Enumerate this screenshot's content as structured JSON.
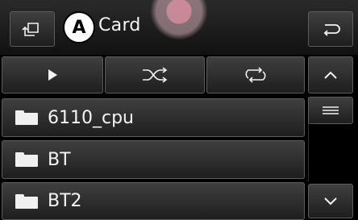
{
  "header": {
    "title": "Card",
    "annotation_marker": "A"
  },
  "controls": {
    "play": "play-icon",
    "shuffle": "shuffle-icon",
    "repeat": "repeat-icon"
  },
  "nav": {
    "back": "back-icon",
    "home": "folder-up-icon",
    "scroll_up": "^",
    "scroll_down": "v",
    "scroll_handle": "≡"
  },
  "list": {
    "items": [
      {
        "label": "6110_cpu"
      },
      {
        "label": "BT"
      },
      {
        "label": "BT2"
      }
    ]
  },
  "colors": {
    "background": "#000000",
    "button": "#2b2b2b",
    "text": "#f4f4f4",
    "watermark": "#ffb6c4"
  }
}
